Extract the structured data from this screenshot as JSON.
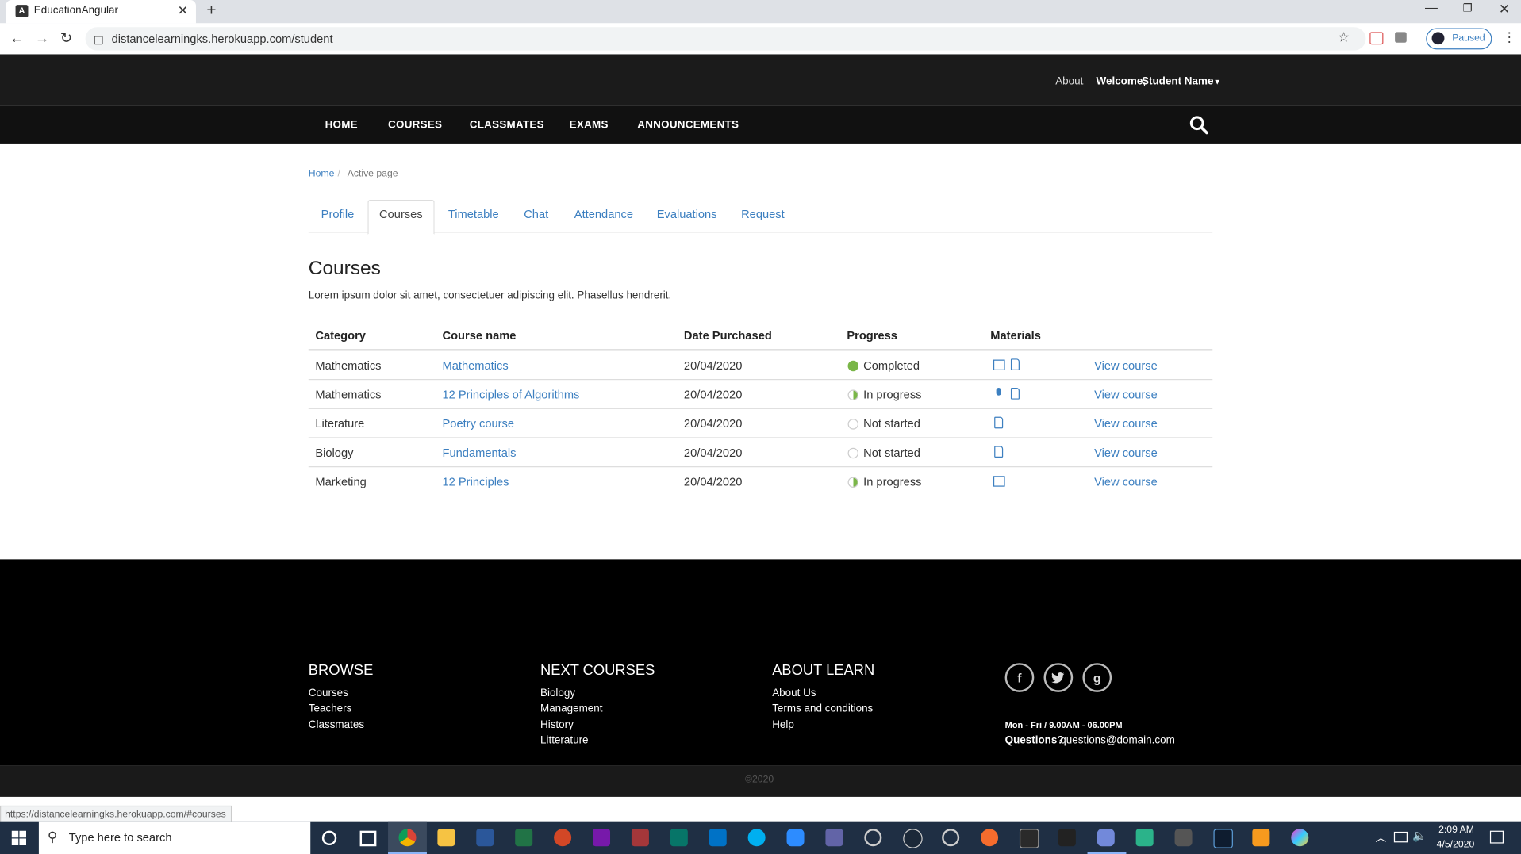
{
  "browser": {
    "tab_title": "EducationAngular",
    "url": "distancelearningks.herokuapp.com/student",
    "profile_status": "Paused",
    "status_url": "https://distancelearningks.herokuapp.com/#courses"
  },
  "header": {
    "about": "About",
    "welcome": "Welcome,",
    "user_name": "Student Name"
  },
  "nav": [
    "HOME",
    "COURSES",
    "CLASSMATES",
    "EXAMS",
    "ANNOUNCEMENTS"
  ],
  "breadcrumb": {
    "home": "Home",
    "sep": "/",
    "active": "Active page"
  },
  "tabs": [
    "Profile",
    "Courses",
    "Timetable",
    "Chat",
    "Attendance",
    "Evaluations",
    "Request"
  ],
  "active_tab": "Courses",
  "section": {
    "title": "Courses",
    "description": "Lorem ipsum dolor sit amet, consectetuer adipiscing elit. Phasellus hendrerit."
  },
  "table": {
    "headers": [
      "Category",
      "Course name",
      "Date Purchased",
      "Progress",
      "Materials"
    ],
    "view_label": "View course",
    "rows": [
      {
        "category": "Mathematics",
        "course": "Mathematics",
        "date": "20/04/2020",
        "progress": "Completed",
        "materials": [
          "video-icon",
          "document-icon"
        ]
      },
      {
        "category": "Mathematics",
        "course": "12 Principles of Algorithms",
        "date": "20/04/2020",
        "progress": "In progress",
        "materials": [
          "microphone-icon",
          "document-icon"
        ]
      },
      {
        "category": "Literature",
        "course": "Poetry course",
        "date": "20/04/2020",
        "progress": "Not started",
        "materials": [
          "document-icon"
        ]
      },
      {
        "category": "Biology",
        "course": "Fundamentals",
        "date": "20/04/2020",
        "progress": "Not started",
        "materials": [
          "document-icon"
        ]
      },
      {
        "category": "Marketing",
        "course": "12 Principles",
        "date": "20/04/2020",
        "progress": "In progress",
        "materials": [
          "video-icon"
        ]
      }
    ]
  },
  "footer": {
    "browse": {
      "title": "BROWSE",
      "links": [
        "Courses",
        "Teachers",
        "Classmates"
      ]
    },
    "next": {
      "title": "NEXT COURSES",
      "links": [
        "Biology",
        "Management",
        "History",
        "Litterature"
      ]
    },
    "about": {
      "title": "ABOUT LEARN",
      "links": [
        "About Us",
        "Terms and conditions",
        "Help"
      ]
    },
    "social": {
      "facebook": "f",
      "google": "g"
    },
    "hours": "Mon - Fri / 9.00AM - 06.00PM",
    "questions_label": "Questions?",
    "email": "questions@domain.com",
    "copyright": "©2020"
  },
  "taskbar": {
    "search_placeholder": "Type here to search",
    "time": "2:09 AM",
    "date": "4/5/2020"
  },
  "colors": {
    "link": "#3c7fc0",
    "completed": "#7ab648",
    "navbar": "#111111",
    "footer": "#000000",
    "taskbar": "#1f2f44"
  }
}
